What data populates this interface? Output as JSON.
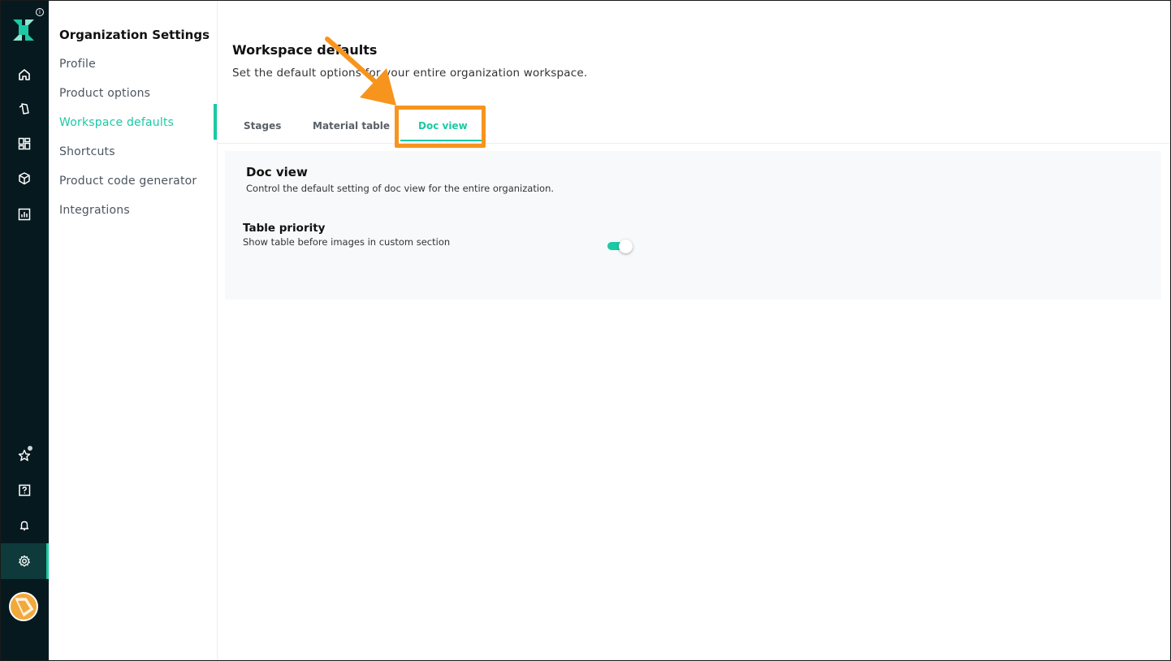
{
  "rail": {
    "items": [
      {
        "icon": "home-icon"
      },
      {
        "icon": "tag-icon"
      },
      {
        "icon": "dashboard-icon"
      },
      {
        "icon": "box-icon"
      },
      {
        "icon": "chart-icon"
      },
      {
        "icon": "star-icon"
      },
      {
        "icon": "help-icon"
      },
      {
        "icon": "bell-icon"
      },
      {
        "icon": "gear-icon"
      }
    ],
    "accent_color": "#1cc9a4",
    "background_color": "#06191f"
  },
  "sidebar": {
    "title": "Organization Settings",
    "items": [
      {
        "label": "Profile"
      },
      {
        "label": "Product options"
      },
      {
        "label": "Workspace defaults"
      },
      {
        "label": "Shortcuts"
      },
      {
        "label": "Product code generator"
      },
      {
        "label": "Integrations"
      }
    ],
    "active_index": 2
  },
  "main": {
    "title": "Workspace defaults",
    "subtitle": "Set the default options for your entire organization workspace.",
    "tabs": [
      {
        "label": "Stages"
      },
      {
        "label": "Material table"
      },
      {
        "label": "Doc view"
      }
    ],
    "active_tab": "Doc view",
    "card": {
      "title": "Doc view",
      "subtitle": "Control the default setting of doc view for the entire organization.",
      "setting": {
        "title": "Table priority",
        "description": "Show table before images in custom section",
        "enabled": true
      }
    }
  },
  "annotation": {
    "highlight_color": "#f7941d"
  }
}
